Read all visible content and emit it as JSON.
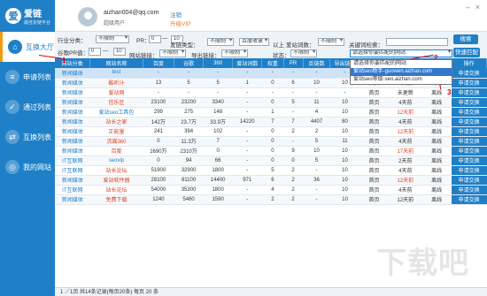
{
  "app": {
    "logo_char": "爱",
    "name": "爱链",
    "tagline": "最佳友链平台"
  },
  "sidebar": {
    "items": [
      {
        "label": "互换大厅",
        "icon": "home-icon",
        "active": true
      },
      {
        "label": "申请列表",
        "icon": "list-icon",
        "active": false
      },
      {
        "label": "通过列表",
        "icon": "check-icon",
        "active": false
      },
      {
        "label": "互换列表",
        "icon": "swap-icon",
        "active": false
      },
      {
        "label": "我的网站",
        "icon": "globe-icon",
        "active": false
      }
    ]
  },
  "header": {
    "email": "aizhan004@qq.com",
    "role": "超级用户",
    "logout": "注销",
    "vip": "升级VIP",
    "win_min": "–",
    "win_close": "×"
  },
  "filters": {
    "industry_label": "行业分类：",
    "industry_value": "不限制",
    "pr_label": "PR：",
    "pr_from": "0",
    "pr_to": "10",
    "pr_dash": "—",
    "publish_label": "发链类型：",
    "publish_value": "不限制",
    "baidu_value": "百度收录",
    "above_label": "以上",
    "keyword_label": "爱站词数：",
    "keyword_value": "不限制",
    "keyword_search_label": "关键词检索：",
    "keyword_search_value": "",
    "google_label": "谷歌PR值：",
    "g_from": "0",
    "g_to": "10",
    "g_dash": "—",
    "links_label": "网站链接：",
    "links_value": "不限制",
    "export_label": "导出链接：",
    "export_value": "不限制",
    "status_label": "状态：",
    "status_value": "不限制",
    "site_select": "请选择你要匹配的网站",
    "search_btn": "搜索",
    "fast_btn": "快速匹配",
    "dropdown": [
      "请选择你要匹配的网站",
      "爱站seo助手-guowen.aizhan.com",
      "爱站seo等级-seo.aizhan.com"
    ]
  },
  "table": {
    "columns": [
      "网站分类",
      "网站名称",
      "百度",
      "谷歌",
      "360",
      "爱站词数",
      "权重",
      "PR",
      "反链数",
      "导出链接",
      "网站",
      "更新",
      "状态",
      "操作"
    ],
    "rows": [
      [
        "新闻媒体",
        "test",
        "-",
        "-",
        "-",
        "-",
        "-",
        "-",
        "-",
        "-",
        "-",
        "-",
        "-",
        "申请交换"
      ],
      [
        "新闻媒体",
        "酷听汁",
        "13",
        "5",
        "5",
        "1",
        "0",
        "6",
        "10",
        "10",
        "首页",
        "4天前",
        "离线",
        "申请交换"
      ],
      [
        "新闻媒体",
        "爱站网",
        "-",
        "-",
        "-",
        "-",
        "-",
        "-",
        "-",
        "-",
        "首页",
        "未更新",
        "离线",
        "申请交换"
      ],
      [
        "新闻媒体",
        "信乐区",
        "23100",
        "23200",
        "3340",
        "-",
        "0",
        "5",
        "11",
        "10",
        "首页",
        "4天前",
        "离线",
        "申请交换"
      ],
      [
        "新闻媒体",
        "爱站seo工具包",
        "299",
        "275",
        "148",
        "-",
        "1",
        "-",
        "4",
        "10",
        "首页",
        "12天前",
        "离线",
        "申请交换"
      ],
      [
        "新闻媒体",
        "站长之家",
        "142万",
        "23.7万",
        "33.9万",
        "14220",
        "7",
        "7",
        "4407",
        "80",
        "首页",
        "4天前",
        "离线",
        "申请交换"
      ],
      [
        "新闻媒体",
        "正能量",
        "241",
        "394",
        "102",
        "-",
        "0",
        "2",
        "2",
        "10",
        "首页",
        "12天前",
        "离线",
        "申请交换"
      ],
      [
        "新闻媒体",
        "流媒360",
        "0",
        "11.3万",
        "7",
        "-",
        "0",
        "-",
        "5",
        "11",
        "首页",
        "4天前",
        "离线",
        "申请交换"
      ],
      [
        "新闻媒体",
        "百度",
        "1690万",
        "2310万",
        "0",
        "-",
        "0",
        "9",
        "10",
        "10",
        "首页",
        "17天前",
        "离线",
        "申请交换"
      ],
      [
        "IT互联网",
        "seovip",
        "0",
        "94",
        "66",
        "-",
        "0",
        "0",
        "5",
        "10",
        "首页",
        "2天前",
        "离线",
        "申请交换"
      ],
      [
        "IT互联网",
        "站长论坛",
        "51900",
        "32900",
        "1800",
        "-",
        "5",
        "2",
        "-",
        "10",
        "首页",
        "4天前",
        "离线",
        "申请交换"
      ],
      [
        "新闻媒体",
        "爱站软件器",
        "28100",
        "81100",
        "14400",
        "971",
        "6",
        "2",
        "36",
        "10",
        "首页",
        "12天前",
        "离线",
        "申请交换"
      ],
      [
        "IT互联网",
        "站长论坛",
        "54000",
        "35300",
        "1800",
        "-",
        "4",
        "2",
        "-",
        "10",
        "首页",
        "4天前",
        "离线",
        "申请交换"
      ],
      [
        "新闻媒体",
        "免费下载",
        "1240",
        "5460",
        "1590",
        "-",
        "2",
        "2",
        "-",
        "10",
        "首页",
        "12天前",
        "离线",
        "申请交换"
      ]
    ]
  },
  "footer": {
    "text": "1 ／1页  共14条记录(每页20条) 每页 20 条"
  },
  "annotations": {
    "m1": "1",
    "m2": "2",
    "m3": "3"
  },
  "watermark": "下载吧"
}
